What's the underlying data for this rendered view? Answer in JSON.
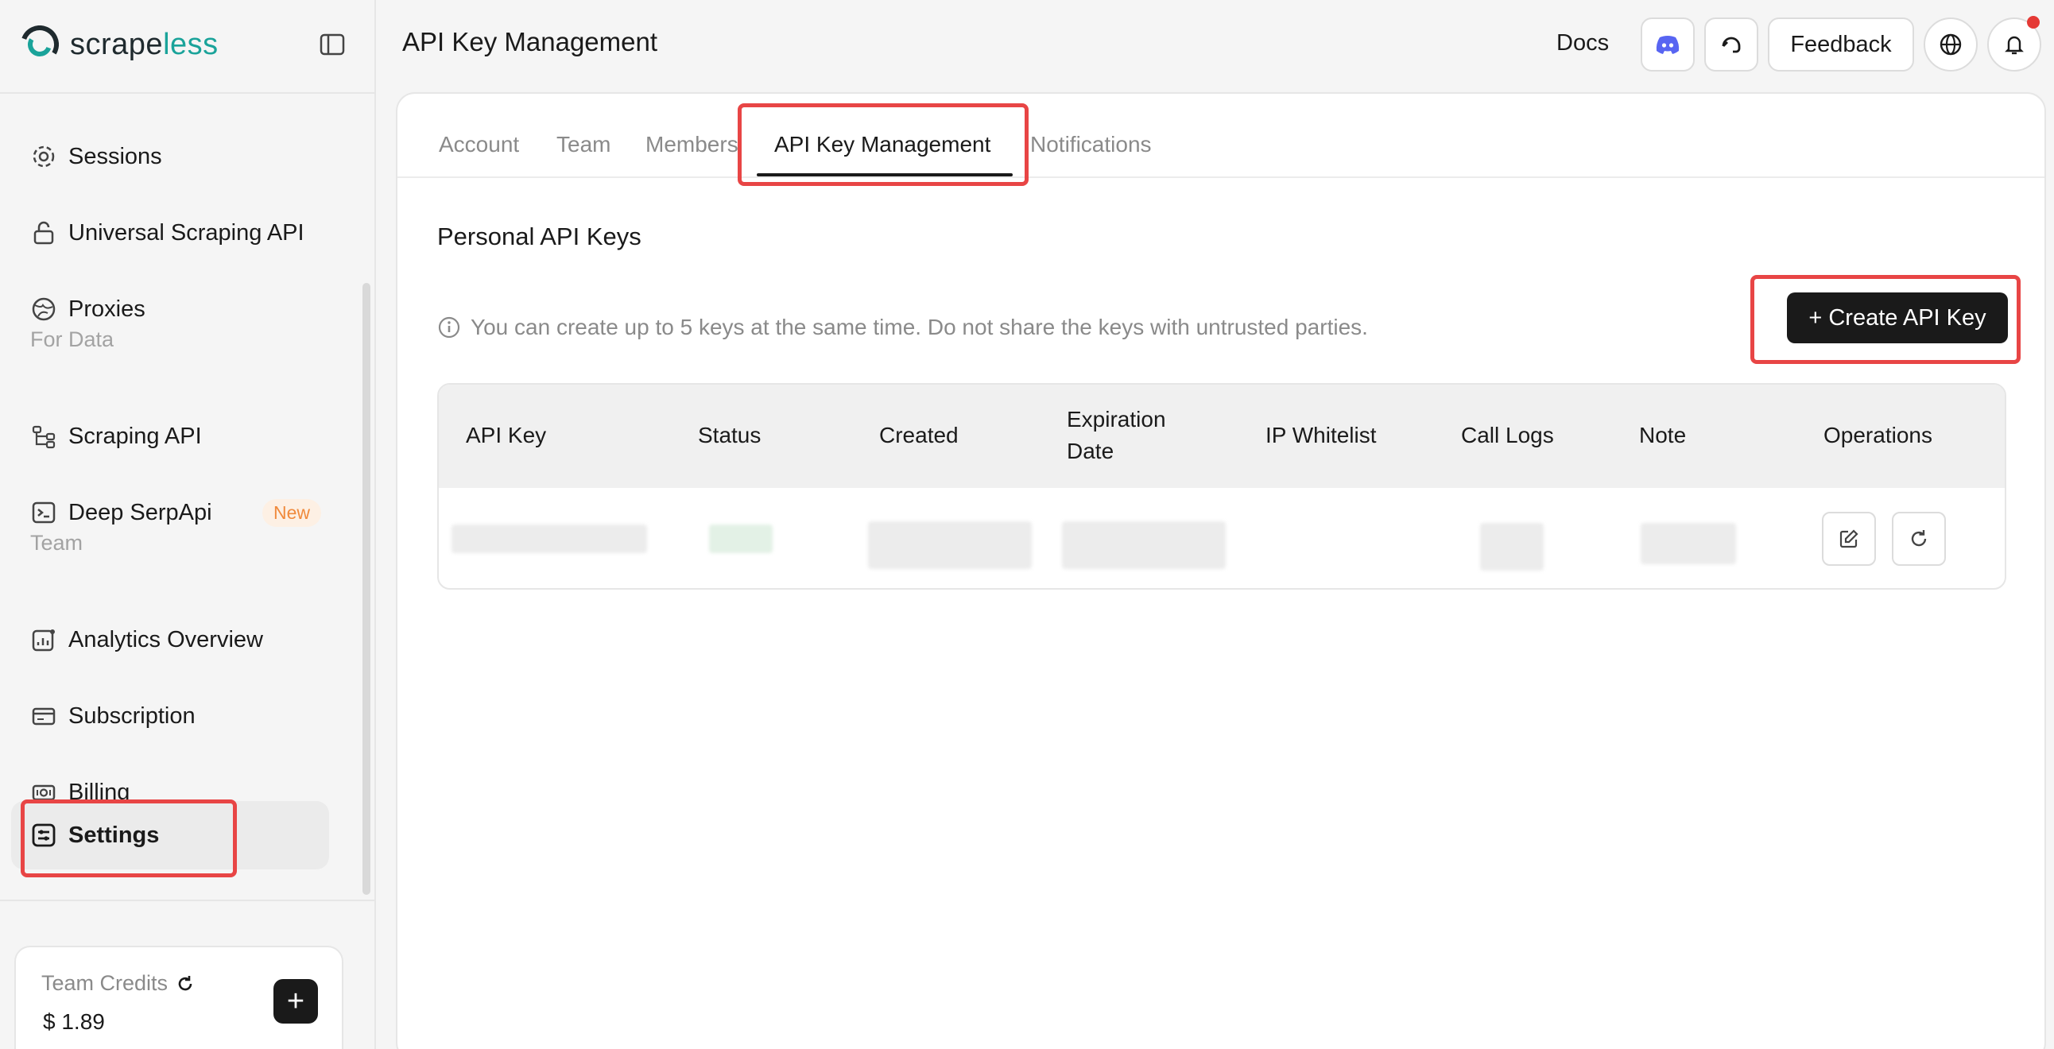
{
  "brand": {
    "name_main": "scrape",
    "name_accent": "less"
  },
  "sidebar": {
    "items": [
      {
        "key": "sessions",
        "label": "Sessions",
        "icon": "sessions-icon"
      },
      {
        "key": "universal",
        "label": "Universal Scraping API",
        "icon": "unlock-icon"
      },
      {
        "key": "proxies",
        "label": "Proxies",
        "icon": "globe-icon"
      },
      {
        "key": "scraping",
        "label": "Scraping API",
        "icon": "flow-icon"
      },
      {
        "key": "serp",
        "label": "Deep SerpApi",
        "icon": "terminal-icon",
        "badge": "New"
      },
      {
        "key": "analytics",
        "label": "Analytics Overview",
        "icon": "chart-icon"
      },
      {
        "key": "subscription",
        "label": "Subscription",
        "icon": "card-icon"
      },
      {
        "key": "billing",
        "label": "Billing",
        "icon": "bill-icon"
      },
      {
        "key": "settings",
        "label": "Settings",
        "icon": "settings-icon",
        "active": true
      }
    ],
    "sections": {
      "for_data": "For Data",
      "team": "Team"
    },
    "credits": {
      "label": "Team Credits",
      "value": "$ 1.89"
    }
  },
  "header": {
    "title": "API Key Management",
    "docs": "Docs",
    "feedback": "Feedback"
  },
  "tabs": [
    "Account",
    "Team",
    "Members",
    "API Key Management",
    "Notifications"
  ],
  "active_tab": "API Key Management",
  "content": {
    "section_title": "Personal API Keys",
    "info": "You can create up to 5 keys at the same time. Do not share the keys with untrusted parties.",
    "create_button": "+ Create API Key"
  },
  "table": {
    "columns": [
      "API Key",
      "Status",
      "Created",
      "Expiration Date",
      "IP Whitelist",
      "Call Logs",
      "Note",
      "Operations"
    ]
  },
  "colors": {
    "accent": "#1aa39a",
    "highlight": "#e84545",
    "new_badge": "#f08a3c",
    "discord": "#5865f2"
  }
}
